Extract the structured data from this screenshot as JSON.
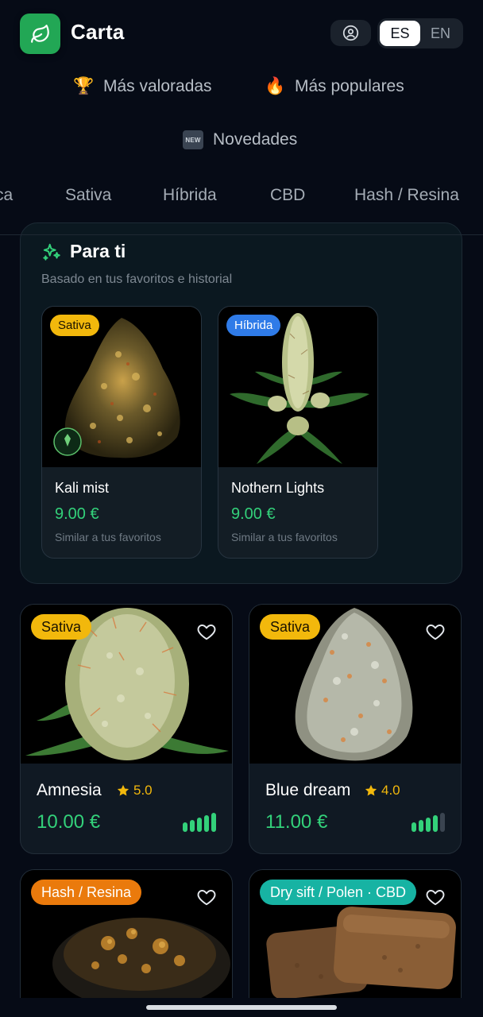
{
  "header": {
    "title": "Carta",
    "languages": [
      "ES",
      "EN"
    ],
    "active_language": "ES"
  },
  "quick_filters": [
    {
      "emoji": "🏆",
      "label": "Más valoradas"
    },
    {
      "emoji": "🔥",
      "label": "Más populares"
    },
    {
      "emoji": "NEW",
      "label": "Novedades"
    }
  ],
  "category_tabs": [
    "ca",
    "Sativa",
    "Híbrida",
    "CBD",
    "Hash / Resina"
  ],
  "para_ti": {
    "title": "Para ti",
    "subtitle": "Basado en tus favoritos e historial",
    "items": [
      {
        "name": "Kali mist",
        "price": "9.00 €",
        "badge": "Sativa",
        "note": "Similar a tus favoritos"
      },
      {
        "name": "Nothern Lights",
        "price": "9.00 €",
        "badge": "Híbrida",
        "note": "Similar a tus favoritos"
      }
    ]
  },
  "products": [
    {
      "name": "Amnesia",
      "rating": "5.0",
      "price": "10.00 €",
      "badge": "Sativa",
      "strength": 5,
      "strength_max": 5
    },
    {
      "name": "Blue dream",
      "rating": "4.0",
      "price": "11.00 €",
      "badge": "Sativa",
      "strength": 4,
      "strength_max": 5
    },
    {
      "badge": "Hash / Resina"
    },
    {
      "badge": "Dry sift / Polen · CBD"
    }
  ],
  "colors": {
    "accent_green": "#33d17a",
    "logo_green": "#22a755",
    "badge_sativa": "#f2b80c",
    "badge_hibrida": "#2f7be8",
    "badge_hash": "#ea7a0c",
    "badge_drysift": "#17b3a3",
    "rating_star": "#f2b80c",
    "background": "#060b16"
  },
  "icons": {
    "logo": "leaf-icon",
    "account": "user-circle-icon",
    "para_ti": "sparkles-icon",
    "favorite": "heart-icon",
    "rating": "star-icon",
    "strength": "signal-bars-icon"
  }
}
